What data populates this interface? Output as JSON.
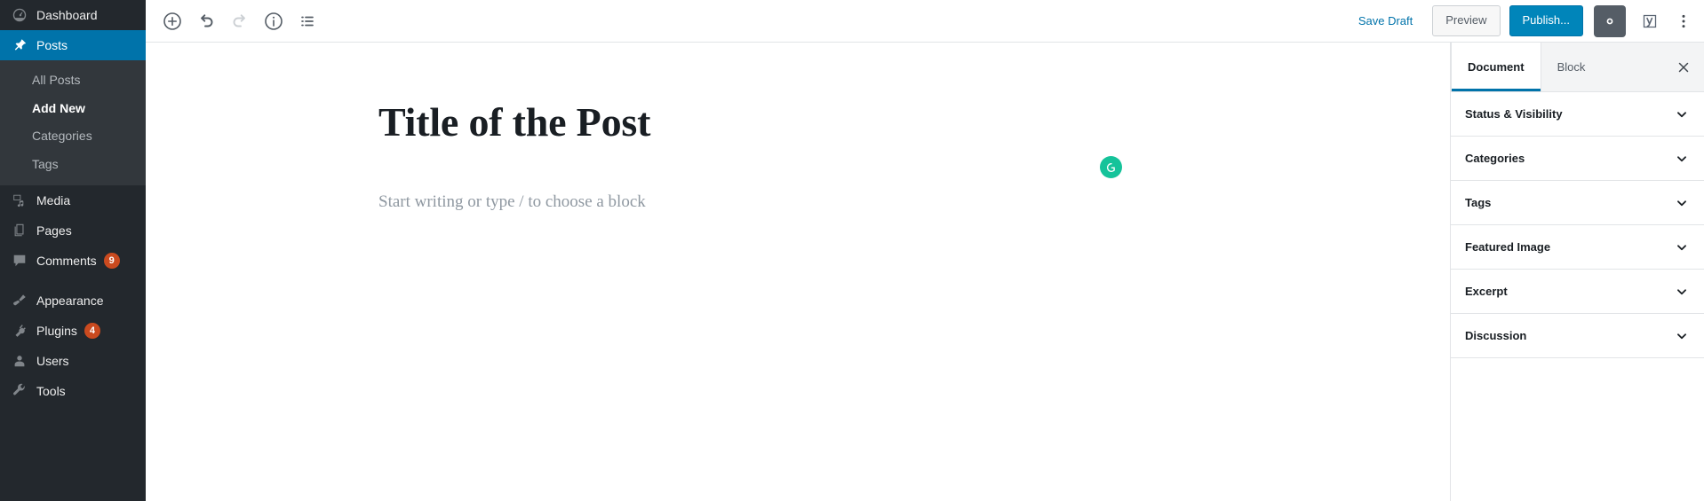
{
  "colors": {
    "sidebar_bg": "#23282d",
    "sidebar_submenu_bg": "#32373c",
    "accent_blue": "#0073aa",
    "publish_blue": "#0085ba",
    "badge_orange": "#ca4a1f",
    "grammarly_green": "#15c39a",
    "gear_dark": "#555d66"
  },
  "admin_sidebar": {
    "items": [
      {
        "label": "Dashboard",
        "icon": "dashboard-icon",
        "current": false,
        "badge": null
      },
      {
        "label": "Posts",
        "icon": "pin-icon",
        "current": true,
        "badge": null
      },
      {
        "label": "Media",
        "icon": "media-icon",
        "current": false,
        "badge": null
      },
      {
        "label": "Pages",
        "icon": "pages-icon",
        "current": false,
        "badge": null
      },
      {
        "label": "Comments",
        "icon": "comment-icon",
        "current": false,
        "badge": "9"
      },
      {
        "label": "Appearance",
        "icon": "brush-icon",
        "current": false,
        "badge": null
      },
      {
        "label": "Plugins",
        "icon": "plug-icon",
        "current": false,
        "badge": "4"
      },
      {
        "label": "Users",
        "icon": "user-icon",
        "current": false,
        "badge": null
      },
      {
        "label": "Tools",
        "icon": "wrench-icon",
        "current": false,
        "badge": null
      }
    ],
    "posts_submenu": [
      {
        "label": "All Posts",
        "current": false
      },
      {
        "label": "Add New",
        "current": true
      },
      {
        "label": "Categories",
        "current": false
      },
      {
        "label": "Tags",
        "current": false
      }
    ]
  },
  "header": {
    "tools": [
      {
        "name": "add-block-icon",
        "label": "Add block",
        "disabled": false
      },
      {
        "name": "undo-icon",
        "label": "Undo",
        "disabled": false
      },
      {
        "name": "redo-icon",
        "label": "Redo",
        "disabled": true
      },
      {
        "name": "info-icon",
        "label": "Content structure",
        "disabled": false
      },
      {
        "name": "block-navigation-icon",
        "label": "Block navigation",
        "disabled": false
      }
    ],
    "save_draft_label": "Save Draft",
    "preview_label": "Preview",
    "publish_label": "Publish...",
    "settings_gear": "gear-icon",
    "yoast": "yoast-seo-icon",
    "more_menu": "more-options-icon"
  },
  "editor": {
    "title": "Title of the Post",
    "placeholder": "Start writing or type / to choose a block",
    "grammarly": {
      "icon": "grammarly-icon",
      "letter": "G"
    }
  },
  "settings_sidebar": {
    "tabs": [
      {
        "label": "Document",
        "active": true
      },
      {
        "label": "Block",
        "active": false
      }
    ],
    "close_icon": "close-icon",
    "panels": [
      {
        "title": "Status & Visibility",
        "expanded": false
      },
      {
        "title": "Categories",
        "expanded": false
      },
      {
        "title": "Tags",
        "expanded": false
      },
      {
        "title": "Featured Image",
        "expanded": false
      },
      {
        "title": "Excerpt",
        "expanded": false
      },
      {
        "title": "Discussion",
        "expanded": false
      }
    ]
  }
}
